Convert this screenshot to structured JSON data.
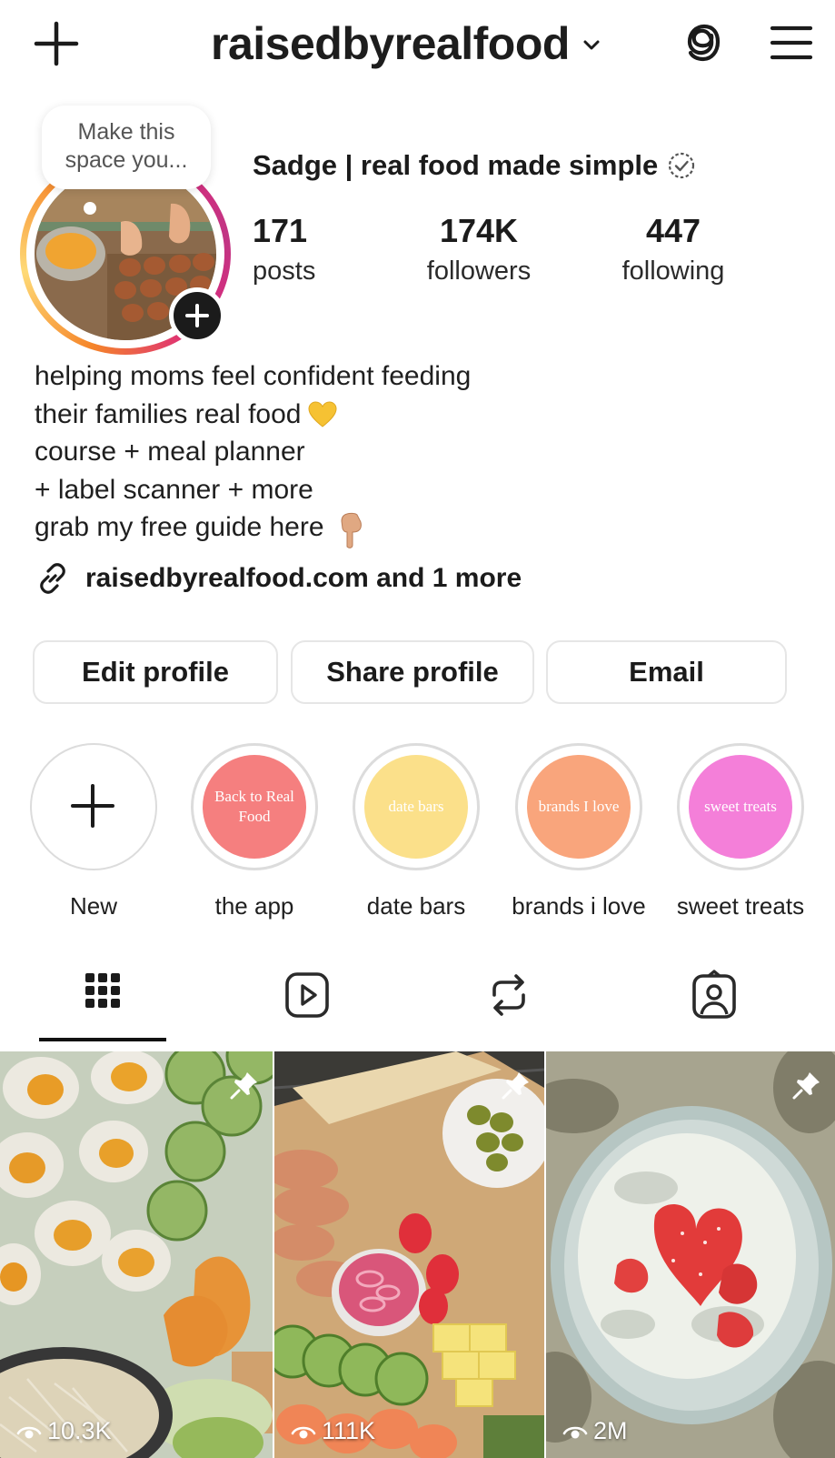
{
  "header": {
    "username": "raisedbyrealfood",
    "icons": [
      "plus-icon",
      "chevron-down-icon",
      "threads-icon",
      "menu-icon"
    ]
  },
  "note": {
    "text_line1": "Make this",
    "text_line2": "space you..."
  },
  "profile": {
    "display_name": "Sadge | real food made simple",
    "stats": {
      "posts_count": "171",
      "posts_label": "posts",
      "followers_count": "174K",
      "followers_label": "followers",
      "following_count": "447",
      "following_label": "following"
    },
    "bio": {
      "line1": "helping moms feel confident feeding",
      "line2": "their families real food",
      "line3": "course + meal planner",
      "line4": "+ label scanner + more",
      "line5": "grab my free guide here"
    },
    "link_text": "raisedbyrealfood.com and 1 more"
  },
  "actions": {
    "edit_label": "Edit profile",
    "share_label": "Share profile",
    "email_label": "Email"
  },
  "highlights": [
    {
      "caption": "New",
      "cover_text": "",
      "color": "#ffffff"
    },
    {
      "caption": "the app",
      "cover_text": "Back to Real Food",
      "color": "#f57f7f"
    },
    {
      "caption": "date bars",
      "cover_text": "date bars",
      "color": "#fbe08a"
    },
    {
      "caption": "brands i love",
      "cover_text": "brands I love",
      "color": "#f9a57c"
    },
    {
      "caption": "sweet treats",
      "cover_text": "sweet treats",
      "color": "#f47fd9"
    }
  ],
  "tabs": [
    {
      "name": "grid-icon",
      "active": true
    },
    {
      "name": "reels-icon",
      "active": false
    },
    {
      "name": "reposts-icon",
      "active": false
    },
    {
      "name": "tagged-icon",
      "active": false
    }
  ],
  "posts": [
    {
      "views": "10.3K",
      "pinned": true
    },
    {
      "views": "111K",
      "pinned": true
    },
    {
      "views": "2M",
      "pinned": true
    }
  ]
}
